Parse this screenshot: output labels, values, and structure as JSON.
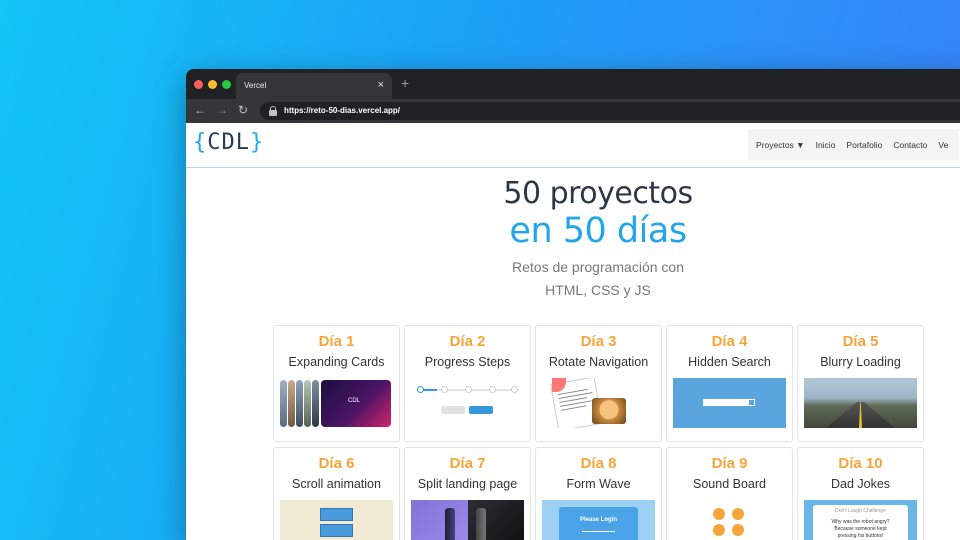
{
  "browser": {
    "tab_title": "Vercel",
    "tab_close": "×",
    "new_tab": "+",
    "url": "https://reto-50-dias.vercel.app/"
  },
  "site": {
    "logo_left": "{",
    "logo_text": "CDL",
    "logo_right": "}",
    "nav": [
      "Proyectos ▼",
      "Inicio",
      "Portafolio",
      "Contacto",
      "Ve"
    ],
    "hero_line1": "50 proyectos",
    "hero_line2": "en 50 días",
    "hero_sub1": "Retos de programación con",
    "hero_sub2": "HTML, CSS y JS"
  },
  "cards": [
    {
      "day": "Día 1",
      "title": "Expanding Cards",
      "thumb_text": "CDL"
    },
    {
      "day": "Día 2",
      "title": "Progress Steps"
    },
    {
      "day": "Día 3",
      "title": "Rotate Navigation"
    },
    {
      "day": "Día 4",
      "title": "Hidden Search"
    },
    {
      "day": "Día 5",
      "title": "Blurry Loading"
    },
    {
      "day": "Día 6",
      "title": "Scroll animation"
    },
    {
      "day": "Día 7",
      "title": "Split landing page"
    },
    {
      "day": "Día 8",
      "title": "Form Wave",
      "thumb_text": "Please Login"
    },
    {
      "day": "Día 9",
      "title": "Sound Board"
    },
    {
      "day": "Día 10",
      "title": "Dad Jokes",
      "thumb_lines": [
        "Don't Laugh Challenge",
        "Why was the robot angry?",
        "Because someone kept",
        "pressing his buttons!"
      ]
    }
  ],
  "colors": {
    "accent_blue": "#21a6ec",
    "accent_orange": "#f7a43a",
    "text_dark": "#2d3748"
  }
}
